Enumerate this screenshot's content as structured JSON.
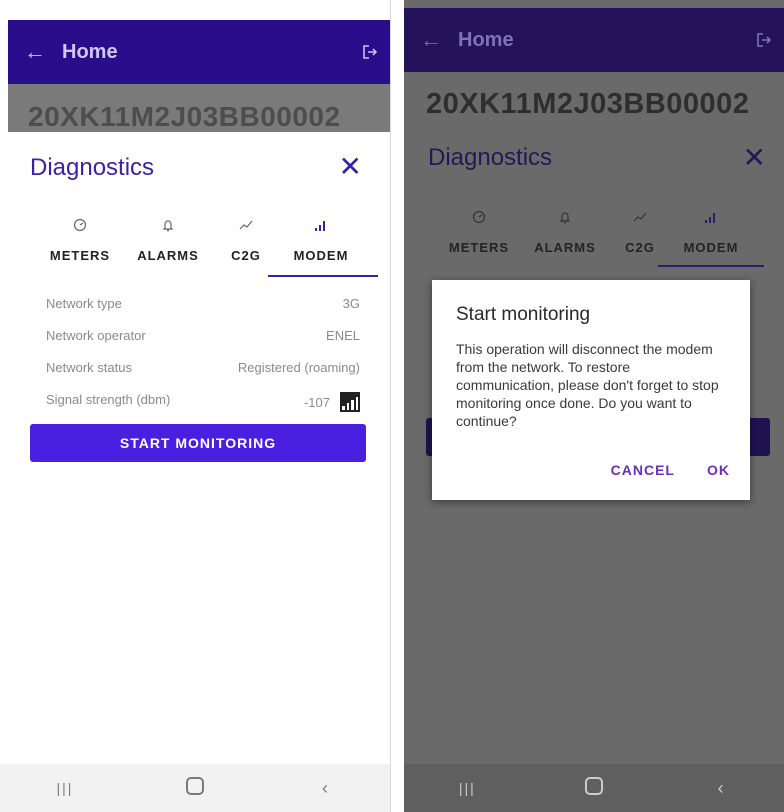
{
  "left": {
    "appbar": {
      "back_icon": "arrow-left-icon",
      "title": "Home",
      "logout_icon": "logout-icon"
    },
    "serial": "20XK11M2J03BB00002",
    "panel": {
      "title": "Diagnostics",
      "close_icon": "close-icon"
    },
    "tabs": [
      {
        "label": "METERS",
        "icon": "gauge-icon"
      },
      {
        "label": "ALARMS",
        "icon": "bell-icon"
      },
      {
        "label": "C2G",
        "icon": "trend-icon"
      },
      {
        "label": "MODEM",
        "icon": "signal-icon",
        "active": true
      }
    ],
    "fields": [
      {
        "label": "Network type",
        "value": "3G"
      },
      {
        "label": "Network operator",
        "value": "ENEL"
      },
      {
        "label": "Network status",
        "value": "Registered (roaming)"
      },
      {
        "label": "Signal strength (dbm)",
        "value": "-107"
      }
    ],
    "button": "START MONITORING"
  },
  "right": {
    "appbar": {
      "back_icon": "arrow-left-icon",
      "title": "Home",
      "logout_icon": "logout-icon"
    },
    "serial": "20XK11M2J03BB00002",
    "panel": {
      "title": "Diagnostics",
      "close_icon": "close-icon"
    },
    "tabs": [
      {
        "label": "METERS",
        "icon": "gauge-icon"
      },
      {
        "label": "ALARMS",
        "icon": "bell-icon"
      },
      {
        "label": "C2G",
        "icon": "trend-icon"
      },
      {
        "label": "MODEM",
        "icon": "signal-icon",
        "active": true
      }
    ],
    "dialog": {
      "title": "Start monitoring",
      "message": "This operation will disconnect the modem from the network. To restore communication, please don't forget to stop monitoring once done. Do you want to continue?",
      "cancel": "CANCEL",
      "ok": "OK"
    }
  },
  "navbar": {
    "recents_icon": "recents-icon",
    "home_icon": "home-icon",
    "back_icon": "nav-back-icon"
  },
  "colors": {
    "appbar": "#2a0d8a",
    "accent": "#3a22a6",
    "button": "#4a1fe0",
    "dialog_action": "#6a2fc0",
    "scrim": "#6a6a6a"
  }
}
